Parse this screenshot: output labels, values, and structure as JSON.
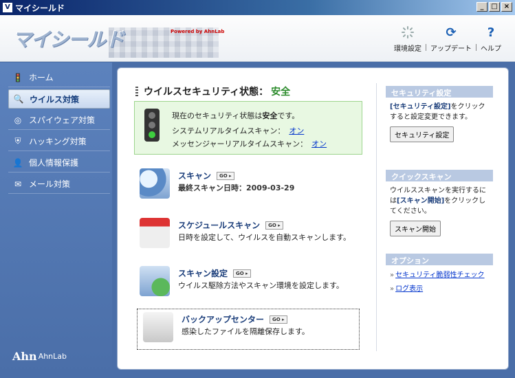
{
  "window": {
    "title": "マイシールド",
    "minimize": "_",
    "maximize": "□",
    "close": "×"
  },
  "header": {
    "logo": "マイシールド",
    "powered": "Powered by AhnLab",
    "tools": [
      {
        "label": "環境設定",
        "icon": "gear-spinner-icon"
      },
      {
        "label": "アップデート",
        "icon": "refresh-icon"
      },
      {
        "label": "ヘルプ",
        "icon": "help-icon"
      }
    ]
  },
  "sidebar": {
    "items": [
      {
        "label": "ホーム",
        "icon": "traffic-light-icon"
      },
      {
        "label": "ウイルス対策",
        "icon": "magnifier-icon"
      },
      {
        "label": "スパイウェア対策",
        "icon": "target-icon"
      },
      {
        "label": "ハッキング対策",
        "icon": "shield-icon"
      },
      {
        "label": "個人情報保護",
        "icon": "person-icon"
      },
      {
        "label": "メール対策",
        "icon": "mail-icon"
      }
    ],
    "brand": "AhnLab",
    "brand_mark": "Ahn"
  },
  "status": {
    "title": "ウイルスセキュリティ状態：",
    "state": "安全",
    "line1_prefix": "現在のセキュリティ状態は",
    "line1_state": "安全",
    "line1_suffix": "です。",
    "realtime_label": "システムリアルタイムスキャン：",
    "realtime_value": "オン",
    "messenger_label": "メッセンジャーリアルタイムスキャン：",
    "messenger_value": "オン"
  },
  "features": [
    {
      "title": "スキャン",
      "desc": "最終スキャン日時：2009-03-29",
      "go": "GO ▸"
    },
    {
      "title": "スケジュールスキャン",
      "desc": "日時を設定して、ウイルスを自動スキャンします。",
      "go": "GO ▸"
    },
    {
      "title": "スキャン設定",
      "desc": "ウイルス駆除方法やスキャン環境を設定します。",
      "go": "GO ▸"
    },
    {
      "title": "バックアップセンター",
      "desc": "感染したファイルを隔離保存します。",
      "go": "GO ▸"
    }
  ],
  "right": {
    "security": {
      "head": "セキュリティ設定",
      "text_hl": "[セキュリティ設定]",
      "text_rest": "をクリックすると設定変更できます。",
      "button": "セキュリティ設定"
    },
    "quick": {
      "head": "クイックスキャン",
      "text_a": "ウイルススキャンを実行するには",
      "text_hl": "[スキャン開始]",
      "text_b": "をクリックしてください。",
      "button": "スキャン開始"
    },
    "options": {
      "head": "オプション",
      "links": [
        "セキュリティ脆弱性チェック",
        "ログ表示"
      ]
    }
  }
}
